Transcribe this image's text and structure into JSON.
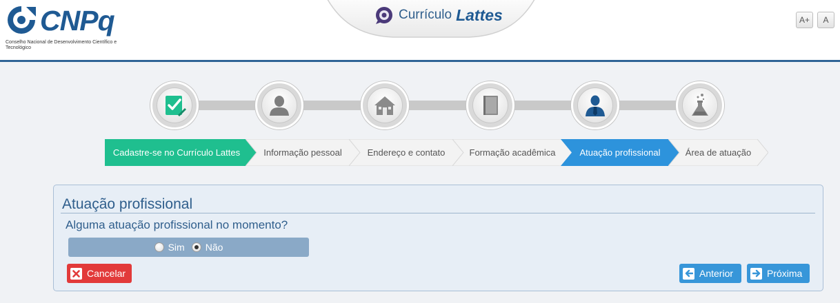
{
  "header": {
    "logo_text": "CNPq",
    "logo_subtitle": "Conselho Nacional de Desenvolvimento Científico e Tecnológico",
    "app_title_part1": "Currículo",
    "app_title_part2": "Lattes",
    "font_increase_label": "A+",
    "font_reset_label": "A"
  },
  "steps": [
    {
      "label": "Cadastre-se no Currículo Lattes",
      "icon": "register-check-icon",
      "state": "done"
    },
    {
      "label": "Informação pessoal",
      "icon": "person-icon",
      "state": "pending"
    },
    {
      "label": "Endereço e contato",
      "icon": "house-icon",
      "state": "pending"
    },
    {
      "label": "Formação acadêmica",
      "icon": "book-icon",
      "state": "pending"
    },
    {
      "label": "Atuação profissional",
      "icon": "professional-icon",
      "state": "active"
    },
    {
      "label": "Área de atuação",
      "icon": "flask-icon",
      "state": "pending"
    }
  ],
  "colors": {
    "done": "#1fbf8f",
    "active": "#2d93dc",
    "pending": "#f1f1f1",
    "brand": "#1f5a93",
    "cancel": "#e23a3a"
  },
  "panel": {
    "title": "Atuação profissional",
    "question": "Alguma atuação profissional no momento?",
    "options": [
      {
        "label": "Sim",
        "checked": false
      },
      {
        "label": "Não",
        "checked": true
      }
    ]
  },
  "buttons": {
    "cancel": "Cancelar",
    "previous": "Anterior",
    "next": "Próxima"
  }
}
